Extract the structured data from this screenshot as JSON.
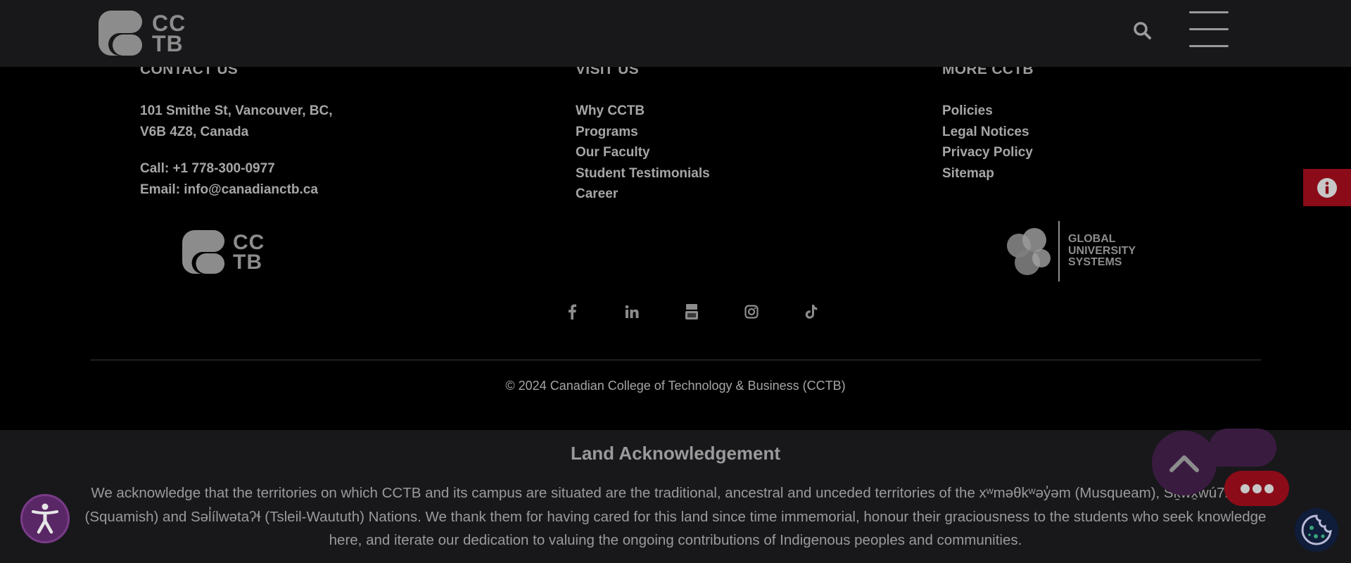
{
  "header": {
    "logo_text_top": "CC",
    "logo_text_bottom": "TB"
  },
  "contact": {
    "heading": "CONTACT US",
    "address_line1": "101 Smithe St, Vancouver, BC,",
    "address_line2": "V6B 4Z8, Canada",
    "phone": "Call: +1 778-300-0977",
    "email": "Email: info@canadianctb.ca"
  },
  "visit": {
    "heading": "VISIT US",
    "links": [
      "Why CCTB",
      "Programs",
      "Our Faculty",
      "Student Testimonials",
      "Career"
    ]
  },
  "more": {
    "heading": "MORE CCTB",
    "links": [
      "Policies",
      "Legal Notices",
      "Privacy Policy",
      "Sitemap"
    ]
  },
  "footer_logo": {
    "text_top": "CC",
    "text_bottom": "TB"
  },
  "gus_logo": {
    "line1": "GLOBAL",
    "line2": "UNIVERSITY",
    "line3": "SYSTEMS"
  },
  "socials": [
    "facebook-icon",
    "linkedin-icon",
    "youtube-icon",
    "instagram-icon",
    "tiktok-icon"
  ],
  "copyright": "© 2024 Canadian College of Technology & Business (CCTB)",
  "land_ack": {
    "title": "Land Acknowledgement",
    "text": "We acknowledge that the territories on which CCTB and its campus are situated are the traditional, ancestral and unceded territories of the xʷməθkʷəy̓əm (Musqueam), Sḵwx̱wú7mesh (Squamish) and Səl̓ílwətaʔɬ (Tsleil-Waututh) Nations. We thank them for having cared for this land since time immemorial, honour their graciousness to the students who seek knowledge here, and iterate our dedication to valuing the ongoing contributions of Indigenous peoples and communities."
  },
  "colors": {
    "topbar": "#18181b",
    "footer": "#000000",
    "accent_red": "#8b0c18",
    "accent_purple": "#5a2766"
  }
}
